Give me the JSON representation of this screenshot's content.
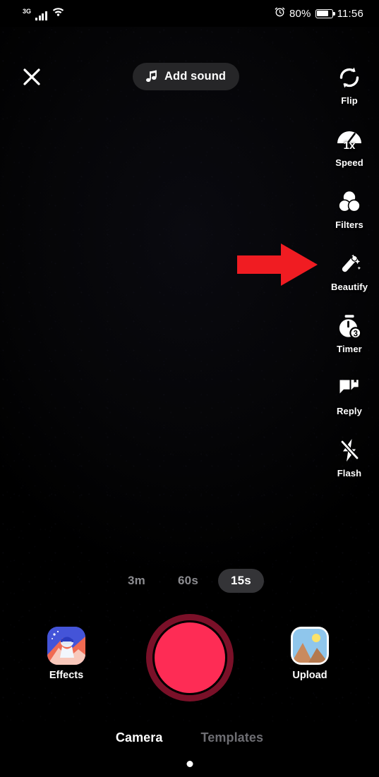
{
  "status_bar": {
    "network_type": "3G",
    "signal_icon": "signal-bars-icon",
    "wifi_icon": "wifi-icon",
    "alarm_icon": "alarm-clock-icon",
    "battery_percent": "80%",
    "battery_icon": "battery-icon",
    "time": "11:56"
  },
  "top_bar": {
    "close_icon": "close-x-icon",
    "add_sound": {
      "label": "Add sound",
      "icon": "music-note-icon"
    }
  },
  "sidebar": {
    "items": [
      {
        "label": "Flip",
        "icon": "flip-camera-icon"
      },
      {
        "label": "Speed",
        "icon": "speed-gauge-icon",
        "badge": "1x"
      },
      {
        "label": "Filters",
        "icon": "filters-circles-icon"
      },
      {
        "label": "Beautify",
        "icon": "magic-wand-icon"
      },
      {
        "label": "Timer",
        "icon": "stopwatch-icon",
        "badge": "3"
      },
      {
        "label": "Reply",
        "icon": "reply-bubble-icon"
      },
      {
        "label": "Flash",
        "icon": "flash-off-icon"
      }
    ]
  },
  "annotation": {
    "arrow_icon": "red-arrow-right-icon",
    "arrow_color": "#f01c22",
    "points_at": "Beautify"
  },
  "durations": {
    "options": [
      {
        "label": "3m",
        "selected": false
      },
      {
        "label": "60s",
        "selected": false
      },
      {
        "label": "15s",
        "selected": true
      }
    ]
  },
  "controls": {
    "record_button": {
      "name": "record-button",
      "inner_color": "#fe2c55",
      "ring_color": "#7a1028"
    },
    "effects": {
      "label": "Effects",
      "icon": "effects-thumbnail-icon"
    },
    "upload": {
      "label": "Upload",
      "icon": "photo-gallery-icon"
    }
  },
  "bottom_tabs": {
    "tabs": [
      {
        "label": "Camera",
        "active": true
      },
      {
        "label": "Templates",
        "active": false
      }
    ],
    "home_indicator": "home-dot-indicator"
  },
  "theme": {
    "background": "#000000",
    "accent": "#fe2c55",
    "pill_background": "#262628",
    "inactive_text": "#6e6e73"
  }
}
